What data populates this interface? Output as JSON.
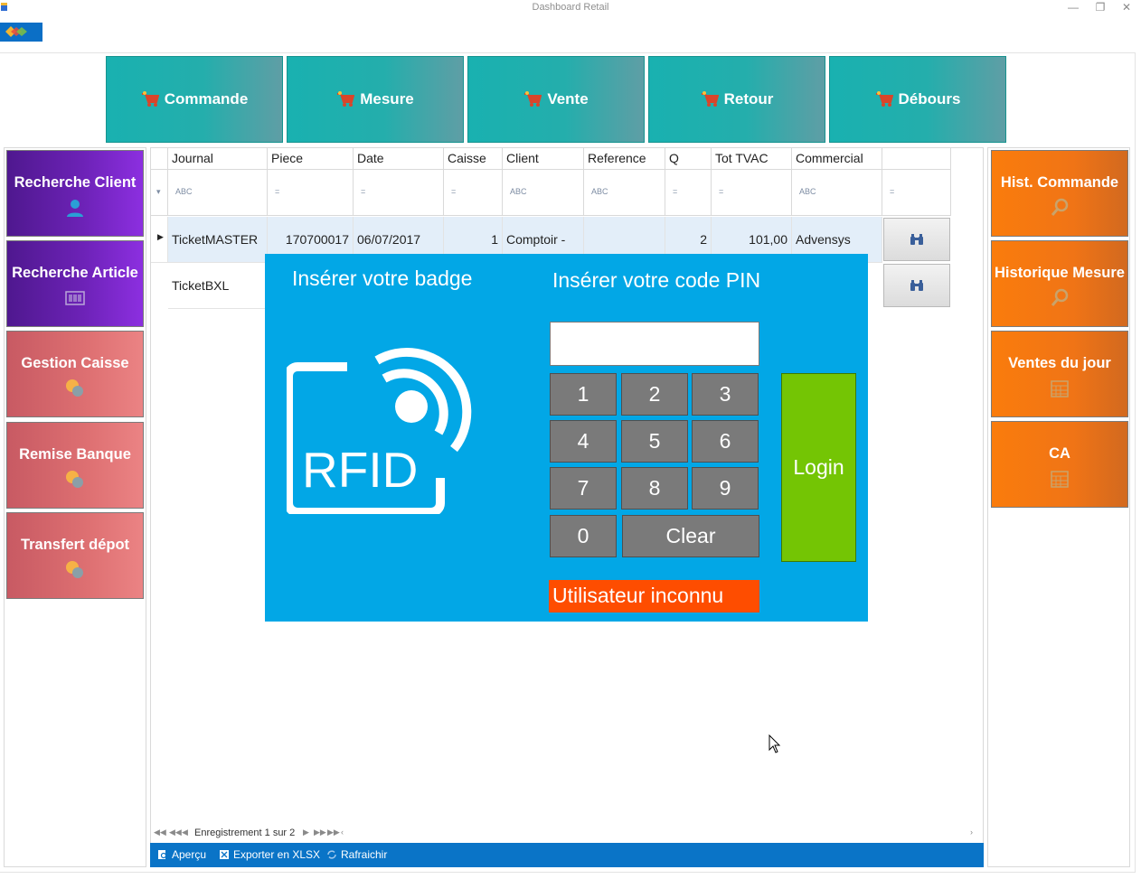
{
  "window": {
    "title": "Dashboard Retail",
    "minimize_icon": "minimize-icon",
    "restore_icon": "restore-icon",
    "close_icon": "close-icon"
  },
  "top_buttons": [
    {
      "label": "Commande",
      "icon": "cart-icon"
    },
    {
      "label": "Mesure",
      "icon": "cart-icon"
    },
    {
      "label": "Vente",
      "icon": "cart-icon"
    },
    {
      "label": "Retour",
      "icon": "cart-icon"
    },
    {
      "label": "Débours",
      "icon": "cart-icon"
    }
  ],
  "left_buttons": [
    {
      "label": "Recherche Client",
      "icon": "user-icon"
    },
    {
      "label": "Recherche Article",
      "icon": "barcode-icon"
    },
    {
      "label": "Gestion Caisse",
      "icon": "coins-icon"
    },
    {
      "label": "Remise Banque",
      "icon": "coins-icon"
    },
    {
      "label": "Transfert dépot",
      "icon": "coins-icon"
    }
  ],
  "right_buttons": [
    {
      "label": "Hist. Commande",
      "icon": "search-icon"
    },
    {
      "label": "Historique Mesure",
      "icon": "search-icon"
    },
    {
      "label": "Ventes du jour",
      "icon": "calendar-icon"
    },
    {
      "label": "CA",
      "icon": "calendar-icon"
    }
  ],
  "grid": {
    "columns": [
      "Journal",
      "Piece",
      "Date",
      "Caisse",
      "Client",
      "Reference",
      "Q",
      "Tot TVAC",
      "Commercial"
    ],
    "filter_ops": [
      "ABC",
      "=",
      "=",
      "=",
      "ABC",
      "ABC",
      "=",
      "=",
      "ABC",
      "="
    ],
    "rows": [
      {
        "journal": "TicketMASTER",
        "piece": "170700017",
        "date": "06/07/2017",
        "caisse": "1",
        "client": "Comptoir -",
        "reference": "",
        "q": "2",
        "tot_tvac": "101,00",
        "commercial": "Advensys"
      },
      {
        "journal": "TicketBXL"
      }
    ]
  },
  "pager": {
    "text": "Enregistrement 1 sur 2"
  },
  "bottom_bar": {
    "preview": "Aperçu",
    "export": "Exporter en XLSX",
    "refresh": "Rafraichir"
  },
  "login": {
    "badge_title": "Insérer votre badge",
    "pin_title": "Insérer votre code PIN",
    "rfid_text": "RFID",
    "pin_value": "",
    "keys": [
      "1",
      "2",
      "3",
      "4",
      "5",
      "6",
      "7",
      "8",
      "9",
      "0"
    ],
    "clear": "Clear",
    "login": "Login",
    "status": "Utilisateur inconnu"
  },
  "colors": {
    "teal": "#19b1b0",
    "purple": "#6c22b6",
    "red": "#de7072",
    "orange": "#f07416",
    "modal_blue": "#02a7e6",
    "login_green": "#74c504",
    "status_orange": "#fe4d00",
    "toolbar_blue": "#0a74c7"
  }
}
